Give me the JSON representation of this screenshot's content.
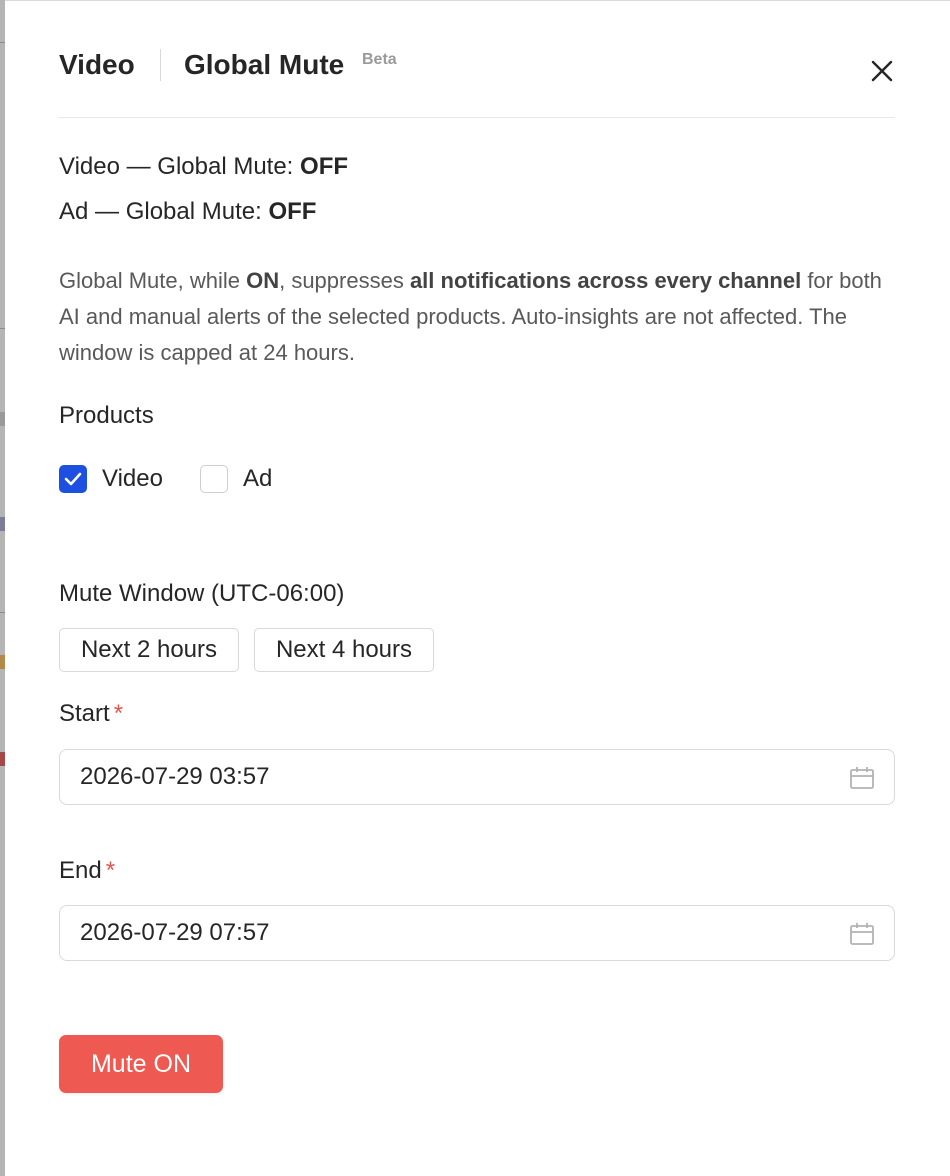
{
  "header": {
    "tab_video": "Video",
    "tab_global_mute": "Global Mute",
    "badge": "Beta"
  },
  "status": {
    "video_prefix": "Video — Global Mute: ",
    "video_value": "OFF",
    "ad_prefix": "Ad — Global Mute: ",
    "ad_value": "OFF"
  },
  "description": {
    "part1": "Global Mute, while ",
    "part2_bold": "ON",
    "part3": ", suppresses ",
    "part4_bold": "all notifications across every channel",
    "part5": " for both AI and manual alerts of the selected products. Auto-insights are not affected. The window is capped at 24 hours."
  },
  "products": {
    "label": "Products",
    "items": [
      {
        "label": "Video",
        "checked": true
      },
      {
        "label": "Ad",
        "checked": false
      }
    ]
  },
  "mute_window": {
    "label": "Mute Window (UTC-06:00)",
    "presets": [
      "Next 2 hours",
      "Next 4 hours"
    ]
  },
  "start": {
    "label": "Start",
    "required_mark": "*",
    "value": "2026-07-29 03:57"
  },
  "end": {
    "label": "End",
    "required_mark": "*",
    "value": "2026-07-29 07:57"
  },
  "actions": {
    "mute_on_label": "Mute ON"
  },
  "colors": {
    "checkbox_checked": "#1d4fe0",
    "primary_button": "#ee5a52",
    "required": "#e5534b"
  },
  "icons": {
    "close": "close-icon",
    "check": "check-icon",
    "calendar": "calendar-icon"
  }
}
